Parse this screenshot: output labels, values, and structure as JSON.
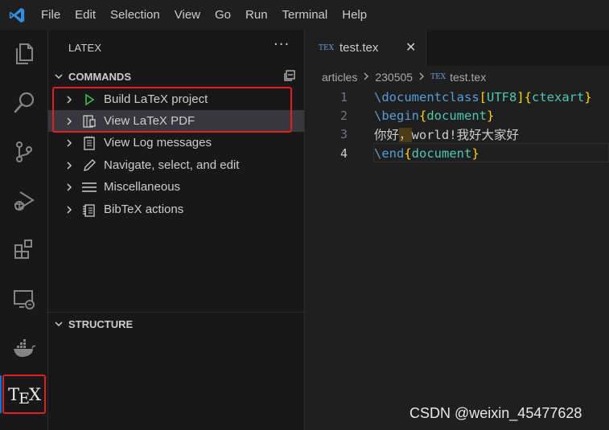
{
  "menu": {
    "items": [
      "File",
      "Edit",
      "Selection",
      "View",
      "Go",
      "Run",
      "Terminal",
      "Help"
    ]
  },
  "activity_bar": {
    "icons": [
      "files-icon",
      "search-icon",
      "source-control-icon",
      "run-debug-icon",
      "extensions-icon",
      "remote-explorer-icon",
      "docker-icon",
      "tex-icon"
    ],
    "tex_logo": {
      "t": "T",
      "e": "E",
      "x": "X"
    }
  },
  "sidebar": {
    "title": "LATEX",
    "more_actions": "···",
    "commands_header": "COMMANDS",
    "commands": [
      {
        "label": "Build LaTeX project",
        "icon": "play-icon"
      },
      {
        "label": "View LaTeX PDF",
        "icon": "pdf-view-icon"
      },
      {
        "label": "View Log messages",
        "icon": "notebook-icon"
      },
      {
        "label": "Navigate, select, and edit",
        "icon": "pencil-icon"
      },
      {
        "label": "Miscellaneous",
        "icon": "menu-lines-icon"
      },
      {
        "label": "BibTeX actions",
        "icon": "bibtex-icon"
      }
    ],
    "structure_header": "STRUCTURE"
  },
  "editor": {
    "tab": {
      "icon_text": "TEX",
      "label": "test.tex",
      "close": "✕"
    },
    "breadcrumb": [
      "articles",
      "230505",
      "test.tex"
    ],
    "line_numbers": [
      "1",
      "2",
      "3",
      "4"
    ],
    "code": {
      "l1_cmd": "\\documentclass",
      "l1_open1": "[",
      "l1_opt": "UTF8",
      "l1_close1": "]",
      "l1_open2": "{",
      "l1_arg": "ctexart",
      "l1_close2": "}",
      "l2_cmd": "\\begin",
      "l2_open": "{",
      "l2_arg": "document",
      "l2_close": "}",
      "l3_a": "你好",
      "l3_highlight": "，",
      "l3_b": "world!我好大家好",
      "l4_cmd": "\\end",
      "l4_open": "{",
      "l4_arg": "document",
      "l4_close": "}"
    }
  },
  "watermark": "CSDN @weixin_45477628",
  "colors": {
    "keyword": "#569cd6",
    "bracket": "#ffd700",
    "argument": "#4ec9b0",
    "highlight_box": "#e02020",
    "accent": "#0078d4"
  }
}
